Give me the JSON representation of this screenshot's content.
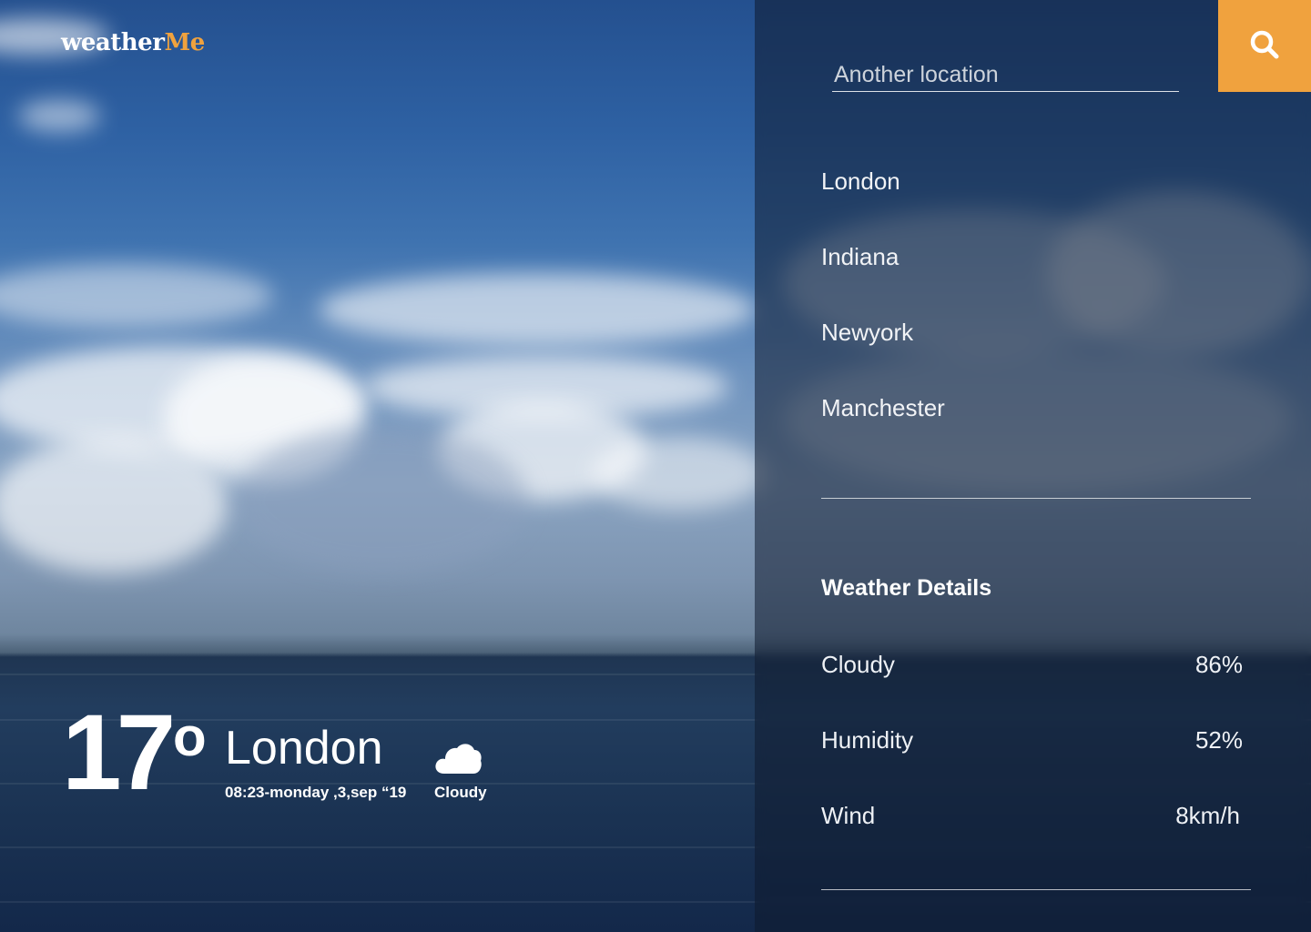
{
  "app": {
    "logo_part1": "weather",
    "logo_part2": "Me"
  },
  "search": {
    "placeholder": "Another location",
    "button_icon": "search-icon"
  },
  "locations": [
    {
      "label": "London"
    },
    {
      "label": "Indiana"
    },
    {
      "label": "Newyork"
    },
    {
      "label": "Manchester"
    }
  ],
  "details": {
    "title": "Weather Details",
    "rows": [
      {
        "label": "Cloudy",
        "value": "86%"
      },
      {
        "label": "Humidity",
        "value": "52%"
      },
      {
        "label": "Wind",
        "value": "8km/h"
      }
    ]
  },
  "current": {
    "temperature": "17",
    "degree_symbol": "o",
    "city": "London",
    "datetime": "08:23-monday ,3,sep “19",
    "condition": "Cloudy",
    "condition_icon": "cloud-icon"
  },
  "colors": {
    "accent": "#f0a23e",
    "panel": "#0f1a2e",
    "text": "#ffffff"
  }
}
